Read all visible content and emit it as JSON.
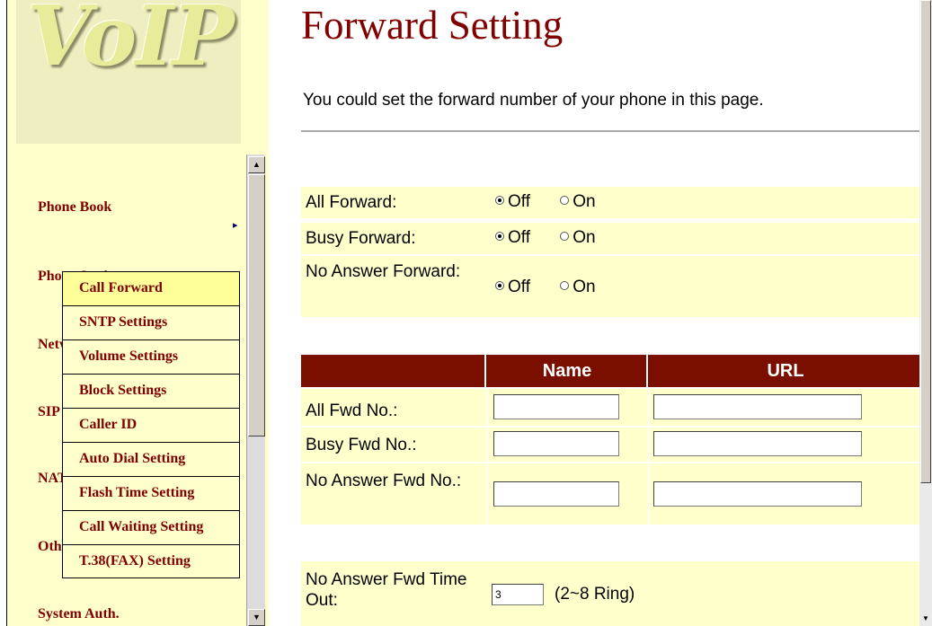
{
  "logo": {
    "text": "VoIP"
  },
  "menu": {
    "phone_book": "Phone Book",
    "phone_setting": "Phone Setting",
    "network": "Network",
    "sip": "SIP",
    "nat": "NAT",
    "other": "Other",
    "system_auth": "System Auth.",
    "arrow": "▸"
  },
  "submenu": [
    "Call Forward",
    "SNTP Settings",
    "Volume Settings",
    "Block Settings",
    "Caller ID",
    "Auto Dial Setting",
    "Flash Time Setting",
    "Call Waiting Setting",
    "T.38(FAX) Setting"
  ],
  "page": {
    "title": "Forward Setting",
    "description": "You could set the forward number of your phone in this page."
  },
  "forward": {
    "all": {
      "label": "All Forward:",
      "off": "Off",
      "on": "On",
      "selected": "Off"
    },
    "busy": {
      "label": "Busy Forward:",
      "off": "Off",
      "on": "On",
      "selected": "Off"
    },
    "noans": {
      "label": "No Answer Forward:",
      "off": "Off",
      "on": "On",
      "selected": "Off"
    }
  },
  "table": {
    "col_name": "Name",
    "col_url": "URL",
    "rows": [
      {
        "label": "All Fwd No.:",
        "name": "",
        "url": ""
      },
      {
        "label": "Busy Fwd No.:",
        "name": "",
        "url": ""
      },
      {
        "label": "No Answer Fwd No.:",
        "name": "",
        "url": ""
      }
    ]
  },
  "timeout": {
    "label": "No Answer Fwd Time Out:",
    "value": "3",
    "hint": "(2~8 Ring)"
  },
  "scrollbar": {
    "up": "▲",
    "down": "▼"
  },
  "colors": {
    "accent": "#800000",
    "header_bg": "#7a0f00",
    "panel_bg": "#ffffcc",
    "submenu_bg": "#ffff99"
  }
}
